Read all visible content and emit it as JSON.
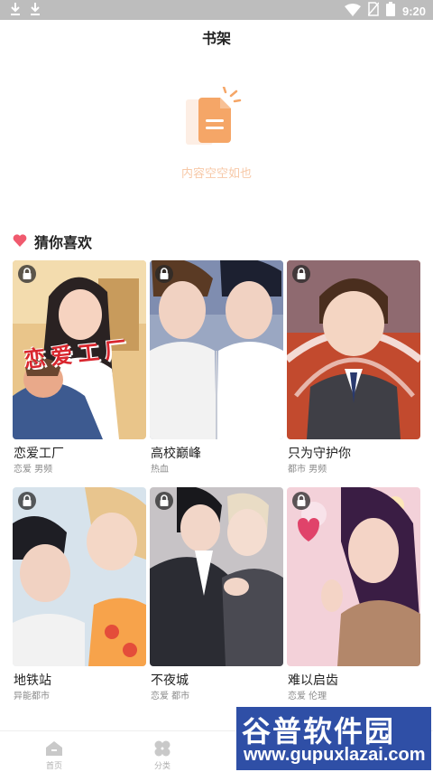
{
  "status_bar": {
    "time": "9:20",
    "left_icons": [
      "download-icon",
      "download-icon"
    ],
    "right_icons": [
      "wifi-icon",
      "no-sim-icon",
      "battery-icon"
    ]
  },
  "header": {
    "title": "书架"
  },
  "empty_state": {
    "icon": "document-icon",
    "text": "内容空空如也"
  },
  "recommend": {
    "icon": "heart-icon",
    "title": "猜你喜欢",
    "items": [
      {
        "title": "恋爱工厂",
        "tags": "恋爱 男频",
        "cover_overlay": "恋爱工厂",
        "locked": true
      },
      {
        "title": "高校巅峰",
        "tags": "热血",
        "locked": true
      },
      {
        "title": "只为守护你",
        "tags": "都市 男频",
        "locked": true
      },
      {
        "title": "地铁站",
        "tags": "异能都市",
        "locked": true
      },
      {
        "title": "不夜城",
        "tags": "恋爱 都市",
        "locked": true
      },
      {
        "title": "难以启齿",
        "tags": "恋爱 伦理",
        "locked": true
      }
    ]
  },
  "tabbar": {
    "tabs": [
      {
        "label": "首页",
        "icon": "home-icon"
      },
      {
        "label": "分类",
        "icon": "category-icon"
      }
    ]
  },
  "watermark": {
    "brand": "谷普软件园",
    "url": "www.gupuxlazai.com"
  },
  "colors": {
    "accent": "#f5a667",
    "heart": "#f05a6e",
    "status_bar": "#bdbdbd"
  }
}
